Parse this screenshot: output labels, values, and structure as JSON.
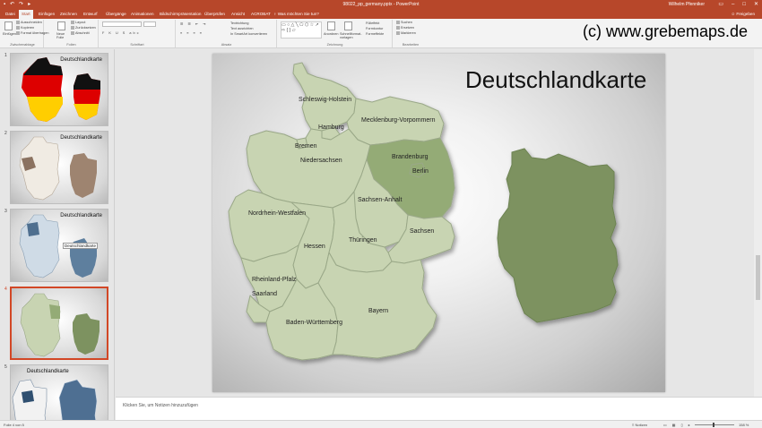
{
  "titlebar": {
    "document_title": "98022_pp_germany.pptx - PowerPoint",
    "user": "Wilhelm Pfenniker"
  },
  "tabs": [
    "Datei",
    "Start",
    "Einfügen",
    "Zeichnen",
    "Entwurf",
    "Übergänge",
    "Animationen",
    "Bildschirmpräsentation",
    "Überprüfen",
    "Ansicht",
    "ACROBAT"
  ],
  "active_tab": "Start",
  "tellme": "Was möchten Sie tun?",
  "share": "Freigeben",
  "ribbon": {
    "groups": {
      "clipboard": "Zwischenablage",
      "slides": "Folien",
      "font": "Schriftart",
      "paragraph": "Absatz",
      "drawing": "Zeichnung",
      "editing": "Bearbeiten"
    },
    "paste": "Einfügen",
    "cut": "Ausschneiden",
    "copy": "Kopieren",
    "format_painter": "Format übertragen",
    "new_slide": "Neue Folie",
    "layout": "Layout",
    "reset": "Zurücksetzen",
    "section": "Abschnitt",
    "text_direction": "Textrichtung",
    "align_text": "Text ausrichten",
    "smartart": "In SmartArt konvertieren",
    "arrange": "Anordnen",
    "quick_styles": "Schnellformat-vorlagen",
    "fill": "Fülleffekt",
    "outline": "Formkontur",
    "effects": "Formeffekte",
    "find": "Suchen",
    "replace": "Ersetzen",
    "select": "Markieren"
  },
  "watermark": "(c) www.grebemaps.de",
  "thumbnails": [
    {
      "number": "1",
      "title": "Deutschlandkarte"
    },
    {
      "number": "2",
      "title": "Deutschlandkarte"
    },
    {
      "number": "3",
      "title": "Deutschlandkarte",
      "label": "Deutschlandkarte"
    },
    {
      "number": "4",
      "title": ""
    },
    {
      "number": "5",
      "title": "Deutschlandkarte"
    }
  ],
  "slide": {
    "title": "Deutschlandkarte",
    "states": [
      "Schleswig-Holstein",
      "Hamburg",
      "Mecklenburg-Vorpommern",
      "Bremen",
      "Niedersachsen",
      "Brandenburg",
      "Berlin",
      "Sachsen-Anhalt",
      "Nordrhein-Westfalen",
      "Sachsen",
      "Hessen",
      "Thüringen",
      "Rheinland-Pfalz",
      "Saarland",
      "Baden-Württemberg",
      "Bayern"
    ],
    "highlighted_state": "Brandenburg",
    "colors": {
      "map_fill": "#c8d4b2",
      "highlight_fill": "#94ab76",
      "silhouette_fill": "#7d9260",
      "border": "#9aa888",
      "accent": "#b7472a"
    }
  },
  "notes_placeholder": "Klicken Sie, um Notizen hinzuzufügen",
  "statusbar": {
    "slide_info": "Folie 4 von 5",
    "notes": "Notizen",
    "zoom": "158 %"
  }
}
